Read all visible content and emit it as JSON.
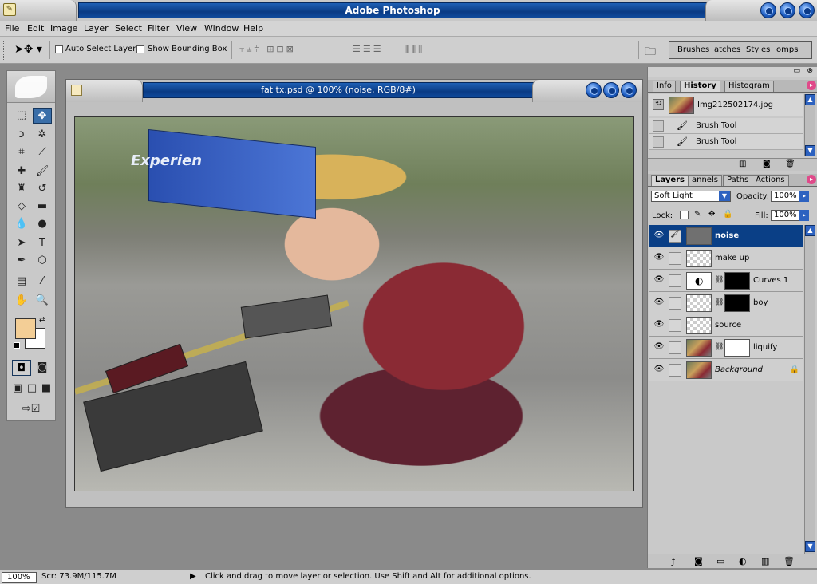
{
  "app": {
    "title": "Adobe Photoshop"
  },
  "menu": [
    "File",
    "Edit",
    "Image",
    "Layer",
    "Select",
    "Filter",
    "View",
    "Window",
    "Help"
  ],
  "options": {
    "auto_select": "Auto Select Layer",
    "bounding_box": "Show Bounding Box"
  },
  "palette_well": [
    "Brushes",
    "atches",
    "Styles",
    "omps"
  ],
  "document": {
    "title": "fat tx.psd @ 100% (noise, RGB/8#)",
    "truck_text": "Experien"
  },
  "colors": {
    "foreground": "#f3ce96",
    "background": "#ffffff",
    "selection": "#0a3f86"
  },
  "history_panel": {
    "tabs": [
      "Info",
      "History",
      "Histogram"
    ],
    "snapshot": "Img212502174.jpg",
    "items": [
      "Brush Tool",
      "Brush Tool"
    ]
  },
  "layers_panel": {
    "tabs": [
      "Layers",
      "annels",
      "Paths",
      "Actions"
    ],
    "blend_mode": "Soft Light",
    "opacity_label": "Opacity:",
    "opacity": "100%",
    "lock_label": "Lock:",
    "fill_label": "Fill:",
    "fill": "100%",
    "layers": [
      {
        "name": "noise"
      },
      {
        "name": "make up"
      },
      {
        "name": "Curves 1"
      },
      {
        "name": "boy"
      },
      {
        "name": "source"
      },
      {
        "name": "liquify"
      },
      {
        "name": "Background"
      }
    ]
  },
  "status": {
    "zoom": "100%",
    "scr": "Scr: 73.9M/115.7M",
    "hint": "Click and drag to move layer or selection.  Use Shift and Alt for additional options."
  }
}
